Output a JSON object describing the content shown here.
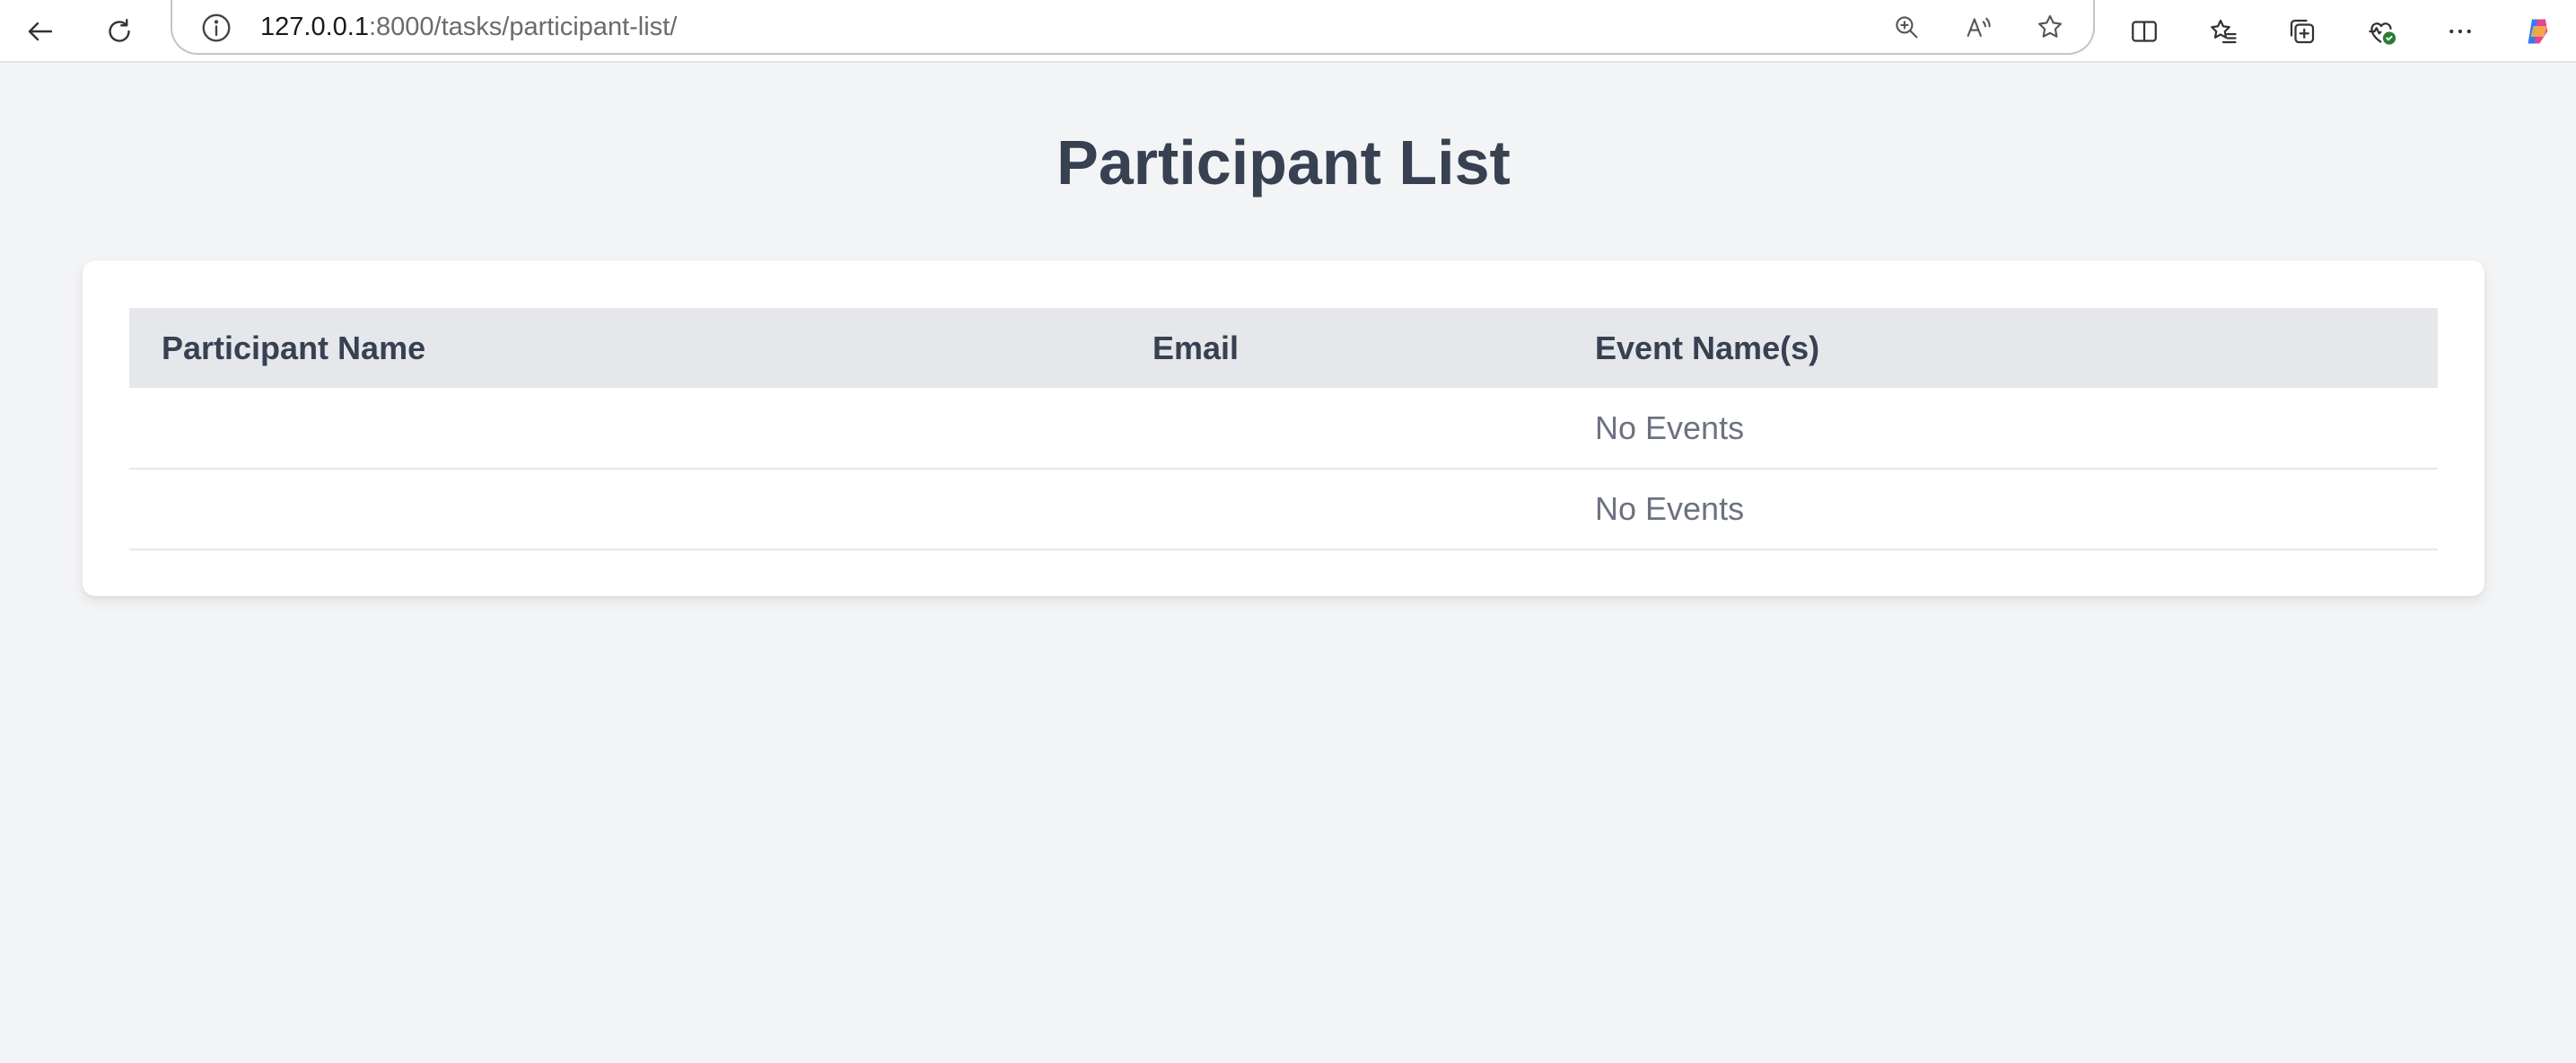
{
  "browser": {
    "url_host": "127.0.0.1",
    "url_rest": ":8000/tasks/participant-list/"
  },
  "page": {
    "title": "Participant List"
  },
  "table": {
    "headers": [
      "Participant Name",
      "Email",
      "Event Name(s)"
    ],
    "rows": [
      {
        "name": "",
        "email": "",
        "events": "No Events"
      },
      {
        "name": "",
        "email": "",
        "events": "No Events"
      }
    ]
  },
  "colors": {
    "background": "#f3f4f6",
    "card": "#ffffff",
    "header_row": "#e5e7eb",
    "heading_text": "#374151",
    "muted_text": "#6b7280"
  },
  "icons": [
    "back-arrow-icon",
    "refresh-icon",
    "info-icon",
    "zoom-in-icon",
    "read-aloud-icon",
    "favorite-star-icon",
    "split-screen-icon",
    "favorites-icon",
    "collections-icon",
    "browser-essentials-icon",
    "more-options-icon",
    "copilot-icon"
  ]
}
